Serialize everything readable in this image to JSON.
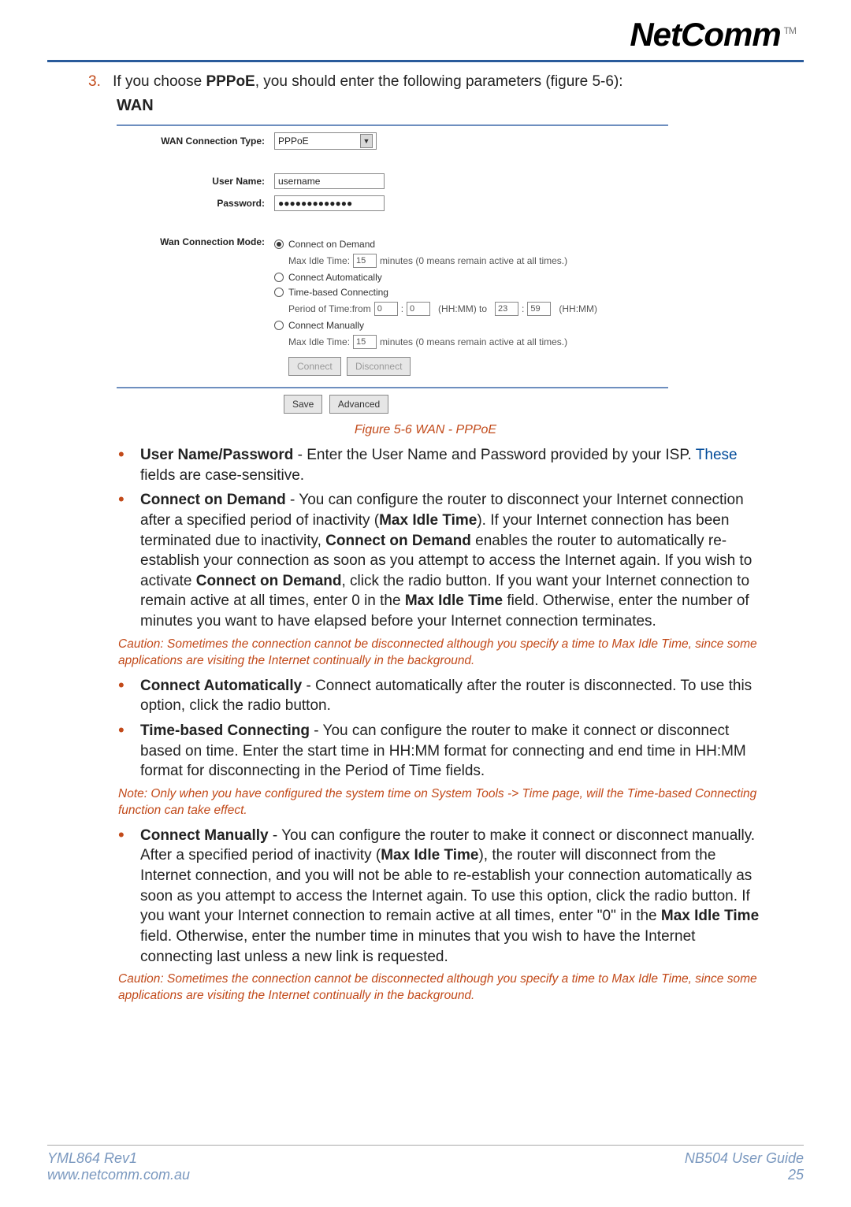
{
  "header": {
    "logo": "NetComm",
    "tm": "TM"
  },
  "step": {
    "num": "3.",
    "text_1": "If you choose ",
    "bold_1": "PPPoE",
    "text_2": ", you should enter the following parameters (figure 5-6):"
  },
  "wan": {
    "title": "WAN",
    "conn_type_label": "WAN Connection Type:",
    "conn_type_value": "PPPoE",
    "user_label": "User Name:",
    "user_value": "username",
    "pass_label": "Password:",
    "pass_value": "●●●●●●●●●●●●●",
    "mode_label": "Wan Connection Mode:",
    "r1": "Connect on Demand",
    "r1_sub_a": "Max Idle Time:",
    "r1_idle": "15",
    "r1_sub_b": "minutes (0 means remain active at all times.)",
    "r2": "Connect Automatically",
    "r3": "Time-based Connecting",
    "r3_sub_a": "Period of Time:from",
    "r3_h1": "0",
    "r3_m1": "0",
    "r3_mid": "(HH:MM) to",
    "r3_h2": "23",
    "r3_m2": "59",
    "r3_end": "(HH:MM)",
    "r4": "Connect Manually",
    "r4_sub_a": "Max Idle Time:",
    "r4_idle": "15",
    "r4_sub_b": "minutes (0 means remain active at all times.)",
    "btn_connect": "Connect",
    "btn_disconnect": "Disconnect",
    "btn_save": "Save",
    "btn_adv": "Advanced"
  },
  "figcap": "Figure 5-6 WAN - PPPoE",
  "b1": {
    "bold": "User Name/Password",
    "text": " - Enter the User Name and Password provided by your ISP. ",
    "link": "These",
    "text2": " fields are case-sensitive."
  },
  "b2": {
    "bold1": "Connect on Demand",
    "t1": " - You can configure the router to disconnect your Internet connection after a specified period of inactivity (",
    "bold2": "Max Idle Time",
    "t2": "). If your Internet connection has been terminated due to inactivity, ",
    "bold3": "Connect on Demand",
    "t3": " enables the router to automatically re-establish your connection as soon as you attempt to access the Internet again. If you wish to activate ",
    "bold4": "Connect on Demand",
    "t4": ", click the radio button. If you want your Internet connection to remain active at all times, enter 0 in the ",
    "bold5": "Max Idle Time",
    "t5": " field. Otherwise, enter the number of minutes you want to have elapsed before your Internet connection terminates."
  },
  "c1": "Caution: Sometimes the connection cannot be disconnected although you specify a time to Max Idle Time, since some applications are visiting the Internet continually in the background.",
  "b3": {
    "bold": "Connect Automatically",
    "text": " - Connect automatically after the router is disconnected. To use this option, click the radio button."
  },
  "b4": {
    "bold": "Time-based Connecting",
    "text": " - You can configure the router to make it connect or disconnect based on time. Enter the start time in HH:MM format for connecting and end time in HH:MM format for disconnecting in the Period of Time fields."
  },
  "c2": "Note: Only when you have configured the system time on System Tools -> Time page, will the Time-based Connecting function can take effect.",
  "b5": {
    "bold1": "Connect Manually",
    "t1": " - You can configure the router to make it connect or disconnect manually. After a specified period of inactivity (",
    "bold2": "Max Idle Time",
    "t2": "), the router will disconnect from the Internet connection, and you will not be able to re-establish your connection automatically as soon as you attempt to access the Internet again. To use this option, click the radio button. If you want your Internet connection to remain active at all times, enter \"0\" in the ",
    "bold3": "Max Idle Time",
    "t3": " field. Otherwise, enter the number time in minutes that you wish to have the Internet connecting last unless a new link is requested."
  },
  "c3": "Caution: Sometimes the connection cannot be disconnected although you specify a time to Max Idle Time, since some applications are visiting the Internet continually in the background.",
  "footer": {
    "l1": "YML864 Rev1",
    "l2": "www.netcomm.com.au",
    "r1": "NB504 User Guide",
    "r2": "25"
  }
}
